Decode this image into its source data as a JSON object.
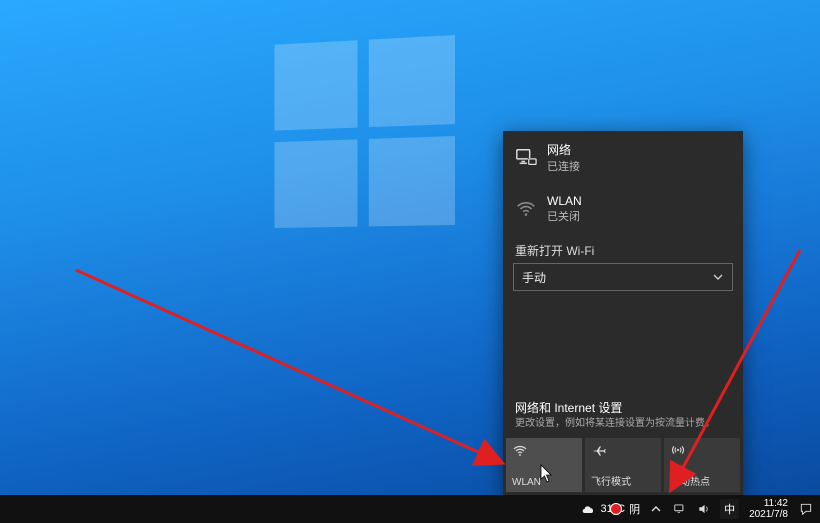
{
  "flyout": {
    "network": {
      "title": "网络",
      "status": "已连接"
    },
    "wlan": {
      "title": "WLAN",
      "status": "已关闭"
    },
    "reopen_label": "重新打开 Wi-Fi",
    "dropdown_value": "手动",
    "settings": {
      "title": "网络和 Internet 设置",
      "subtitle": "更改设置，例如将某连接设置为按流量计费。"
    },
    "tiles": {
      "wlan": "WLAN",
      "airplane": "飞行模式",
      "hotspot": "移动热点"
    }
  },
  "taskbar": {
    "weather_temp": "31°C",
    "weather_cond": "阴",
    "ime": "中",
    "time": "11:42",
    "date": "2021/7/8"
  }
}
